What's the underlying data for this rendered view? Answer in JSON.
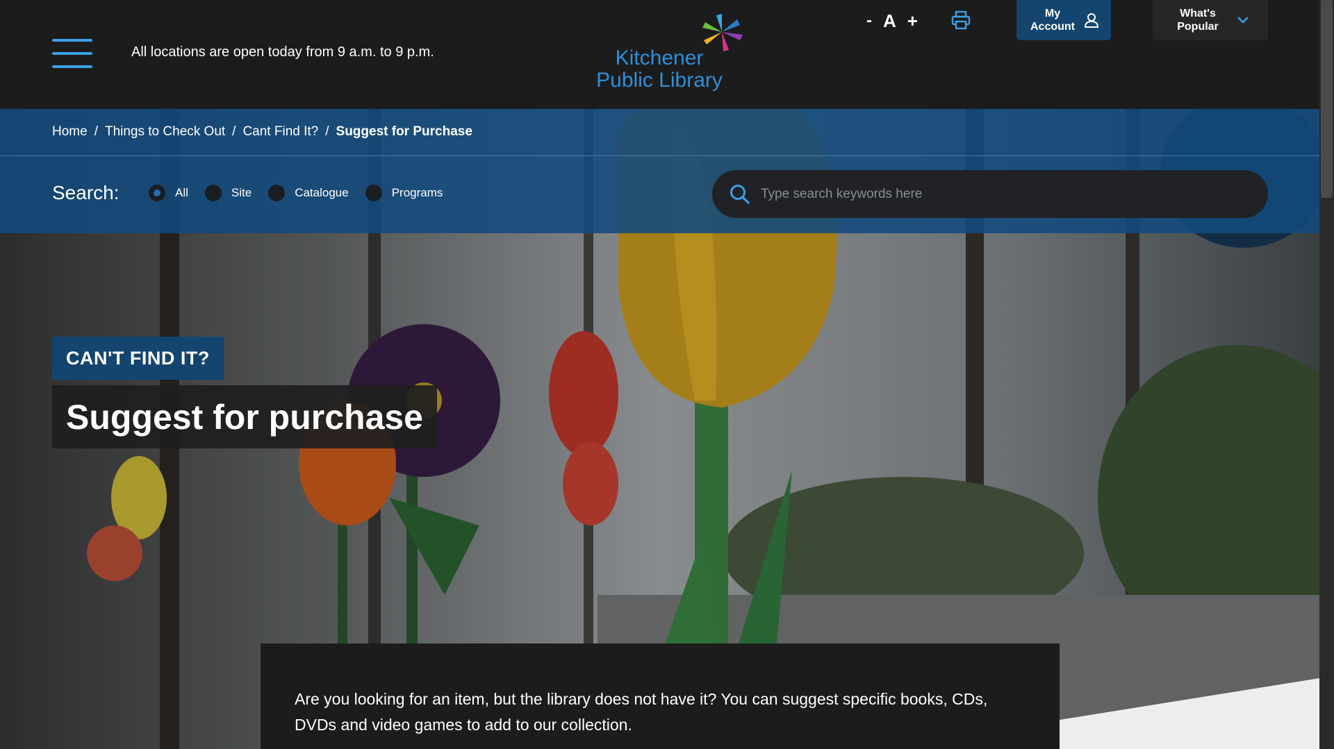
{
  "header": {
    "hours": "All locations are open today from 9 a.m. to 9 p.m.",
    "logo_line1": "Kitchener",
    "logo_line2": "Public Library",
    "font_minus": "-",
    "font_a": "A",
    "font_plus": "+",
    "account_label": "My Account",
    "popular_label": "What's Popular"
  },
  "breadcrumb": {
    "items": [
      "Home",
      "Things to Check Out",
      "Cant Find It?"
    ],
    "current": "Suggest for Purchase",
    "separator": "/"
  },
  "search": {
    "label": "Search:",
    "options": [
      "All",
      "Site",
      "Catalogue",
      "Programs"
    ],
    "selected": "All",
    "placeholder": "Type search keywords here"
  },
  "hero": {
    "kicker": "CAN'T FIND IT?",
    "title": "Suggest for purchase"
  },
  "content": {
    "intro": "Are you looking for an item, but the library does not have it? You can suggest specific books, CDs, DVDs and video games to add to our collection."
  },
  "colors": {
    "header_bg": "#1c1c1d",
    "band_bg": "#124a7c",
    "accent_blue": "#2e8fd8",
    "account_bg": "#13456f"
  },
  "icons": [
    "menu-icon",
    "print-icon",
    "user-icon",
    "chevron-down-icon",
    "search-icon",
    "logo-asterisk-icon"
  ]
}
